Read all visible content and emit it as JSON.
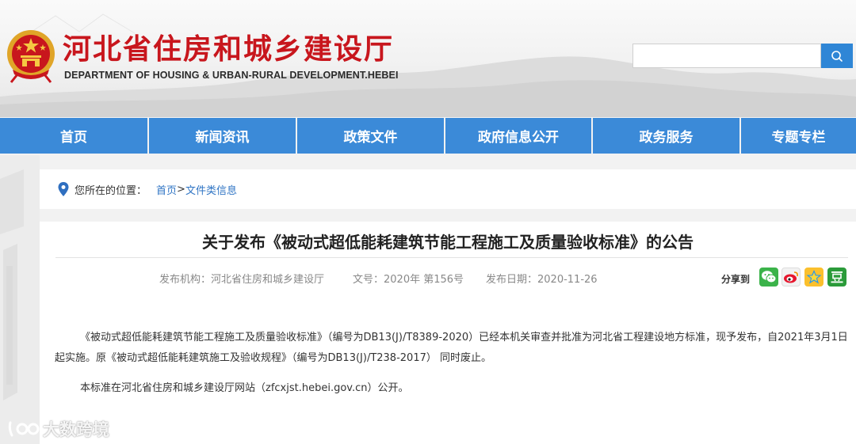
{
  "header": {
    "title": "河北省住房和城乡建设厅",
    "subtitle": "DEPARTMENT OF HOUSING & URBAN-RURAL DEVELOPMENT.HEBEI",
    "emblem_icon": "national-emblem-icon",
    "search": {
      "value": "",
      "placeholder": "",
      "icon": "search-icon"
    }
  },
  "nav": {
    "items": [
      {
        "label": "首页"
      },
      {
        "label": "新闻资讯"
      },
      {
        "label": "政策文件"
      },
      {
        "label": "政府信息公开"
      },
      {
        "label": "政务服务"
      },
      {
        "label": "专题专栏"
      }
    ]
  },
  "breadcrumb": {
    "label": "您所在的位置：",
    "home": "首页",
    "separator": ">",
    "current": "文件类信息",
    "icon": "location-pin-icon"
  },
  "article": {
    "title": "关于发布《被动式超低能耗建筑节能工程施工及质量验收标准》的公告",
    "publisher": "发布机构：河北省住房和城乡建设厅",
    "doc_number": "文号：2020年 第156号",
    "publish_date": "发布日期：2020-11-26",
    "share_label": "分享到",
    "share_icons": [
      "wechat-icon",
      "weibo-icon",
      "qzone-icon",
      "douban-icon"
    ],
    "paragraph_1": "《被动式超低能耗建筑节能工程施工及质量验收标准》（编号为DB13(J)/T8389-2020）已经本机关审查并批准为河北省工程建设地方标准，现予发布，自2021年3月1日起实施。原《被动式超低能耗建筑施工及验收规程》（编号为DB13(J)/T238-2017） 同时废止。",
    "paragraph_2": "本标准在河北省住房和城乡建设厅网站（zfcxjst.hebei.gov.cn）公开。"
  },
  "watermark": {
    "text": "大数跨境",
    "icon": "dashuju-logo-icon"
  },
  "colors": {
    "brand_red": "#c8161d",
    "nav_blue": "#3b8ad8",
    "link_blue": "#2f74c4",
    "search_blue": "#2f86d6"
  }
}
